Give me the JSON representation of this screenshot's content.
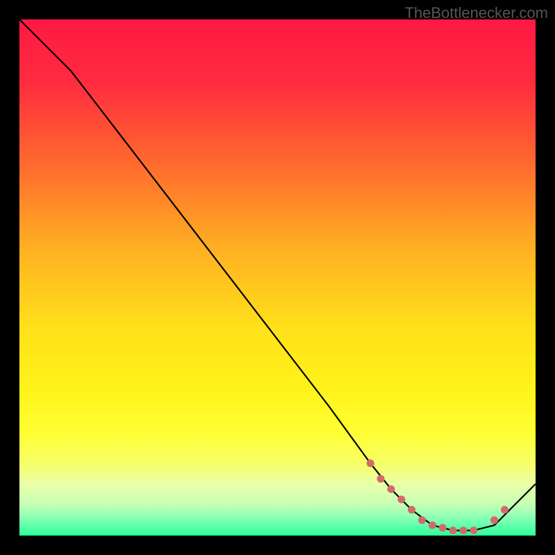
{
  "watermark": "TheBottlenecker.com",
  "chart_data": {
    "type": "line",
    "title": "",
    "xlabel": "",
    "ylabel": "",
    "xlim": [
      0,
      100
    ],
    "ylim": [
      0,
      100
    ],
    "series": [
      {
        "name": "curve",
        "x": [
          0,
          6,
          10,
          20,
          30,
          40,
          50,
          60,
          68,
          72,
          76,
          80,
          84,
          88,
          92,
          96,
          100
        ],
        "values": [
          100,
          94,
          90,
          77,
          64,
          51,
          38,
          25,
          14,
          9,
          5,
          2,
          1,
          1,
          2,
          6,
          10
        ]
      }
    ],
    "markers": {
      "name": "highlight-dots",
      "x": [
        68,
        70,
        72,
        74,
        76,
        78,
        80,
        82,
        84,
        86,
        88,
        92,
        94
      ],
      "values": [
        14,
        11,
        9,
        7,
        5,
        3,
        2,
        1.5,
        1,
        1,
        1,
        3,
        5
      ],
      "color": "#d36a6a"
    },
    "background_gradient": {
      "stops": [
        {
          "offset": 0.0,
          "color": "#ff1943"
        },
        {
          "offset": 0.12,
          "color": "#ff2b3f"
        },
        {
          "offset": 0.28,
          "color": "#ff6a2e"
        },
        {
          "offset": 0.45,
          "color": "#ffb222"
        },
        {
          "offset": 0.6,
          "color": "#ffe11a"
        },
        {
          "offset": 0.72,
          "color": "#fff31a"
        },
        {
          "offset": 0.8,
          "color": "#ffff33"
        },
        {
          "offset": 0.86,
          "color": "#f6ff66"
        },
        {
          "offset": 0.9,
          "color": "#eaffaa"
        },
        {
          "offset": 0.94,
          "color": "#c6ffb4"
        },
        {
          "offset": 0.97,
          "color": "#7dffb4"
        },
        {
          "offset": 1.0,
          "color": "#2bff9a"
        }
      ]
    }
  }
}
